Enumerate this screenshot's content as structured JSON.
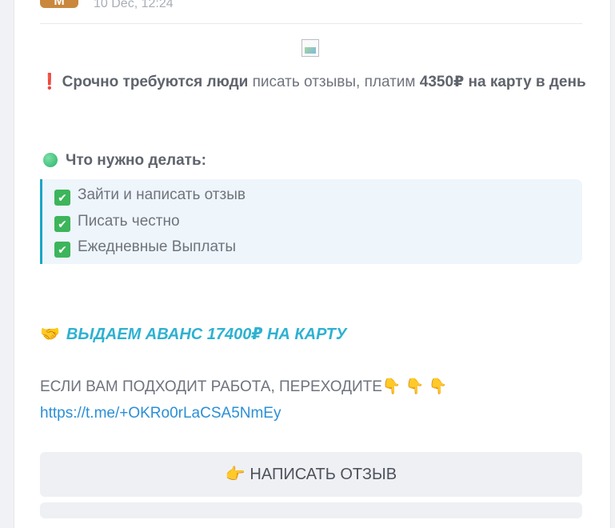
{
  "post": {
    "avatar_letter": "M",
    "timestamp": "10 Dec, 12:24",
    "headline": {
      "icon": "❗",
      "bold_part": "Срочно требуются люди",
      "normal_part": " писать отзывы, платим ",
      "amount_bold": "4350₽ на карту в день"
    },
    "todo_title": "Что нужно делать:",
    "checklist": [
      "Зайти и написать отзыв",
      "Писать честно",
      "Ежедневные Выплаты"
    ],
    "advance_icon": "🤝",
    "advance_text": "ВЫДАЕМ АВАНС 17400₽ НА КАРТУ",
    "cta_text": "ЕСЛИ ВАМ ПОДХОДИТ РАБОТА, ПЕРЕХОДИТЕ",
    "cta_pointers": "👇 👇 👇",
    "link": "https://t.me/+OKRo0rLaCSA5NmEy",
    "button_icon": "👉",
    "button_label": "НАПИСАТЬ ОТЗЫВ"
  },
  "colors": {
    "accent": "#2eb1d1",
    "link": "#2b8fd6",
    "check": "#3cb55b",
    "quote_bg": "#eef5fb"
  }
}
